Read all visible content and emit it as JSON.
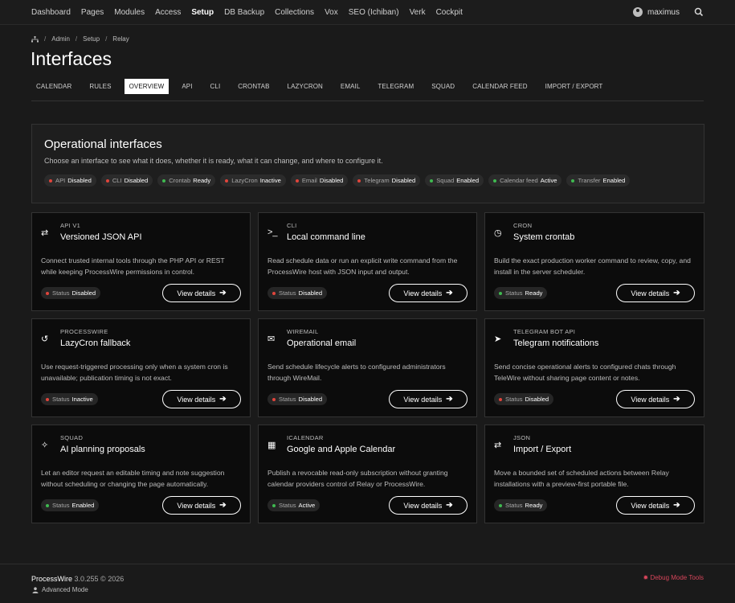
{
  "nav": {
    "items": [
      "Dashboard",
      "Pages",
      "Modules",
      "Access",
      "Setup",
      "DB Backup",
      "Collections",
      "Vox",
      "SEO (Ichiban)",
      "Verk",
      "Cockpit"
    ],
    "active": "Setup",
    "user": "maximus"
  },
  "breadcrumb": [
    "Admin",
    "Setup",
    "Relay"
  ],
  "page_title": "Interfaces",
  "tabs": [
    "CALENDAR",
    "RULES",
    "OVERVIEW",
    "API",
    "CLI",
    "CRONTAB",
    "LAZYCRON",
    "EMAIL",
    "TELEGRAM",
    "SQUAD",
    "CALENDAR FEED",
    "IMPORT / EXPORT"
  ],
  "active_tab": "OVERVIEW",
  "ops": {
    "title": "Operational interfaces",
    "subtitle": "Choose an interface to see what it does, whether it is ready, what it can change, and where to configure it.",
    "chips": [
      {
        "label": "API",
        "value": "Disabled",
        "color": "#e0453c"
      },
      {
        "label": "CLI",
        "value": "Disabled",
        "color": "#e0453c"
      },
      {
        "label": "Crontab",
        "value": "Ready",
        "color": "#3fb950"
      },
      {
        "label": "LazyCron",
        "value": "Inactive",
        "color": "#e0453c"
      },
      {
        "label": "Email",
        "value": "Disabled",
        "color": "#e0453c"
      },
      {
        "label": "Telegram",
        "value": "Disabled",
        "color": "#e0453c"
      },
      {
        "label": "Squad",
        "value": "Enabled",
        "color": "#3fb950"
      },
      {
        "label": "Calendar feed",
        "value": "Active",
        "color": "#3fb950"
      },
      {
        "label": "Transfer",
        "value": "Enabled",
        "color": "#3fb950"
      }
    ]
  },
  "cards": [
    {
      "kicker": "API V1",
      "title": "Versioned JSON API",
      "desc": "Connect trusted internal tools through the PHP API or REST while keeping ProcessWire permissions in control.",
      "icon": "transfer-icon",
      "glyph": "⇄",
      "status": "Disabled",
      "color": "#e0453c"
    },
    {
      "kicker": "CLI",
      "title": "Local command line",
      "desc": "Read schedule data or run an explicit write command from the ProcessWire host with JSON input and output.",
      "icon": "terminal-icon",
      "glyph": ">_",
      "status": "Disabled",
      "color": "#e0453c"
    },
    {
      "kicker": "CRON",
      "title": "System crontab",
      "desc": "Build the exact production worker command to review, copy, and install in the server scheduler.",
      "icon": "clock-icon",
      "glyph": "◷",
      "status": "Ready",
      "color": "#3fb950"
    },
    {
      "kicker": "PROCESSWIRE",
      "title": "LazyCron fallback",
      "desc": "Use request-triggered processing only when a system cron is unavailable; publication timing is not exact.",
      "icon": "history-icon",
      "glyph": "↺",
      "status": "Inactive",
      "color": "#e0453c"
    },
    {
      "kicker": "WIREMAIL",
      "title": "Operational email",
      "desc": "Send schedule lifecycle alerts to configured administrators through WireMail.",
      "icon": "envelope-icon",
      "glyph": "✉",
      "status": "Disabled",
      "color": "#e0453c"
    },
    {
      "kicker": "TELEGRAM BOT API",
      "title": "Telegram notifications",
      "desc": "Send concise operational alerts to configured chats through TeleWire without sharing page content or notes.",
      "icon": "telegram-icon",
      "glyph": "➤",
      "status": "Disabled",
      "color": "#e0453c"
    },
    {
      "kicker": "SQUAD",
      "title": "AI planning proposals",
      "desc": "Let an editor request an editable timing and note suggestion without scheduling or changing the page automatically.",
      "icon": "magic-wand-icon",
      "glyph": "✧",
      "status": "Enabled",
      "color": "#3fb950"
    },
    {
      "kicker": "ICALENDAR",
      "title": "Google and Apple Calendar",
      "desc": "Publish a revocable read-only subscription without granting calendar providers control of Relay or ProcessWire.",
      "icon": "calendar-icon",
      "glyph": "▦",
      "status": "Active",
      "color": "#3fb950"
    },
    {
      "kicker": "JSON",
      "title": "Import / Export",
      "desc": "Move a bounded set of scheduled actions between Relay installations with a preview-first portable file.",
      "icon": "exchange-icon",
      "glyph": "⇄",
      "status": "Ready",
      "color": "#3fb950"
    }
  ],
  "status_label": "Status",
  "details_label": "View details",
  "footer": {
    "brand": "ProcessWire",
    "version": "3.0.255 © 2026",
    "advanced": "Advanced Mode",
    "debug": "Debug Mode Tools"
  }
}
